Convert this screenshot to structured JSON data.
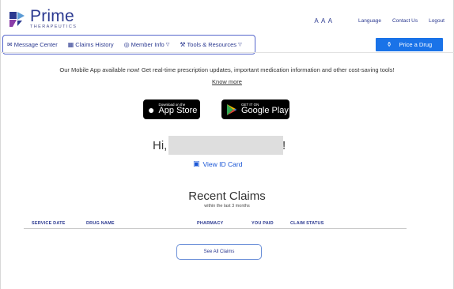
{
  "header": {
    "logo_name": "Prime",
    "logo_sub": "THERAPEUTICS",
    "text_size_label": "A A A",
    "language_label": "Language",
    "contact_label": "Contact Us",
    "logout_label": "Logout"
  },
  "nav": {
    "items": [
      {
        "label": "Message Center"
      },
      {
        "label": "Claims History"
      },
      {
        "label": "Member Info"
      },
      {
        "label": "Tools & Resources"
      }
    ],
    "price_drug_label": "Price a Drug"
  },
  "banner": {
    "text": "Our Mobile App available now! Get real-time prescription updates, important medication information and other cost-saving tools!",
    "know_more": "Know more",
    "app_store_small": "Download on the",
    "app_store_big": "App Store",
    "google_play_small": "GET IT ON",
    "google_play_big": "Google Play"
  },
  "greeting": {
    "hi": "Hi,",
    "punct": "!",
    "view_id_card": "View ID Card"
  },
  "claims": {
    "title": "Recent Claims",
    "subtitle": "within the last 3 months",
    "columns": [
      "SERVICE DATE",
      "DRUG NAME",
      "PHARMACY",
      "YOU PAID",
      "CLAIM STATUS"
    ],
    "see_all": "See All Claims"
  },
  "colors": {
    "brand": "#2b3990",
    "accent": "#1a73e8",
    "nav_outline": "#5566cc"
  }
}
